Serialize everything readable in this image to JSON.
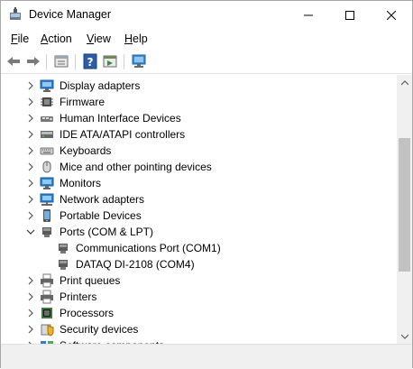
{
  "window": {
    "title": "Device Manager"
  },
  "menu": {
    "file": "File",
    "action": "Action",
    "view": "View",
    "help": "Help"
  },
  "toolbar": {
    "icons": [
      "back-icon",
      "forward-icon",
      "properties-icon",
      "help-icon",
      "update-driver-icon",
      "scan-hardware-icon"
    ]
  },
  "tree": {
    "items": [
      {
        "label": "Display adapters",
        "icon": "monitor-icon",
        "expanded": false
      },
      {
        "label": "Firmware",
        "icon": "chip-icon",
        "expanded": false
      },
      {
        "label": "Human Interface Devices",
        "icon": "hid-icon",
        "expanded": false
      },
      {
        "label": "IDE ATA/ATAPI controllers",
        "icon": "ide-icon",
        "expanded": false
      },
      {
        "label": "Keyboards",
        "icon": "keyboard-icon",
        "expanded": false
      },
      {
        "label": "Mice and other pointing devices",
        "icon": "mouse-icon",
        "expanded": false
      },
      {
        "label": "Monitors",
        "icon": "monitor-icon",
        "expanded": false
      },
      {
        "label": "Network adapters",
        "icon": "network-icon",
        "expanded": false
      },
      {
        "label": "Portable Devices",
        "icon": "portable-icon",
        "expanded": false
      },
      {
        "label": "Ports (COM & LPT)",
        "icon": "port-icon",
        "expanded": true
      },
      {
        "label": "Communications Port (COM1)",
        "icon": "port-icon",
        "child": true
      },
      {
        "label": "DATAQ DI-2108 (COM4)",
        "icon": "port-icon",
        "child": true
      },
      {
        "label": "Print queues",
        "icon": "printer-icon",
        "expanded": false
      },
      {
        "label": "Printers",
        "icon": "printer-icon",
        "expanded": false
      },
      {
        "label": "Processors",
        "icon": "processor-icon",
        "expanded": false
      },
      {
        "label": "Security devices",
        "icon": "security-icon",
        "expanded": false
      },
      {
        "label": "Software components",
        "icon": "software-icon",
        "expanded": false
      }
    ]
  },
  "colors": {
    "accent": "#0078d7",
    "scroll_thumb": "#c2c2c2"
  }
}
